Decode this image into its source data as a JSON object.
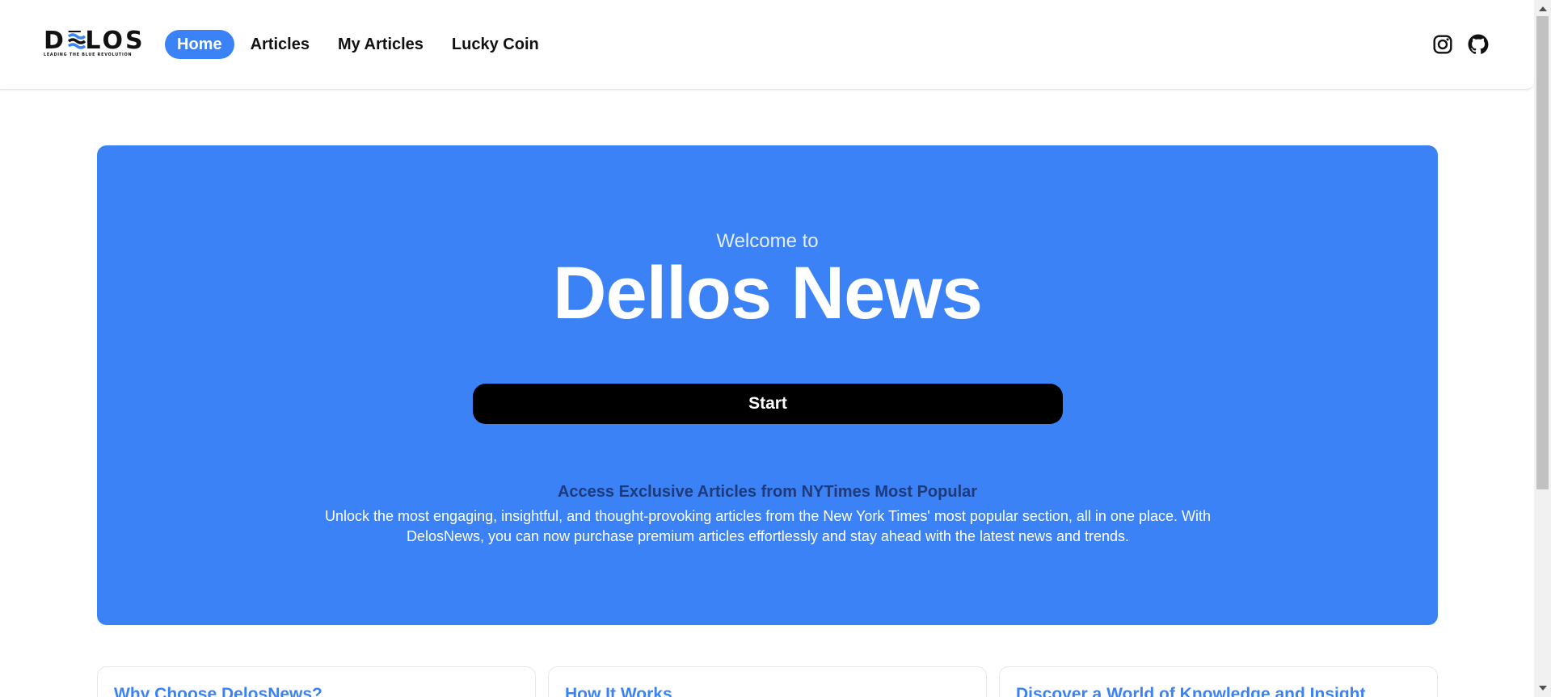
{
  "brand": {
    "logo_text": "DELOS",
    "tagline": "LEADING THE BLUE REVOLUTION"
  },
  "nav": {
    "items": [
      {
        "label": "Home",
        "active": true
      },
      {
        "label": "Articles",
        "active": false
      },
      {
        "label": "My Articles",
        "active": false
      },
      {
        "label": "Lucky Coin",
        "active": false
      }
    ]
  },
  "social": {
    "icons": [
      "instagram-icon",
      "github-icon"
    ]
  },
  "hero": {
    "welcome": "Welcome to",
    "title": "Dellos News",
    "start_label": "Start",
    "subtitle": "Access Exclusive Articles from NYTimes Most Popular",
    "description": "Unlock the most engaging, insightful, and thought-provoking articles from the New York Times' most popular section, all in one place. With DelosNews, you can now purchase premium articles effortlessly and stay ahead with the latest news and trends."
  },
  "cards": [
    {
      "title": "Why Choose DelosNews?"
    },
    {
      "title": "How It Works"
    },
    {
      "title": "Discover a World of Knowledge and Insight"
    }
  ],
  "colors": {
    "accent": "#3b82f6",
    "hero_subtitle": "#1e3a7a",
    "button": "#000000"
  }
}
